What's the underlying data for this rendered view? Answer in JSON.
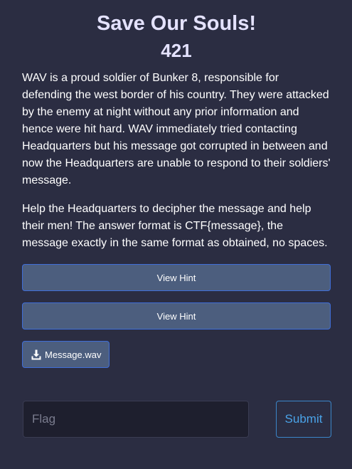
{
  "challenge": {
    "title": "Save Our Souls!",
    "points": "421",
    "description": [
      "WAV is a proud soldier of Bunker 8, responsible for defending the west border of his country. They were attacked by the enemy at night without any prior information and hence were hit hard. WAV immediately tried contacting Headquarters but his message got corrupted in between and now the Headquarters are unable to respond to their soldiers' message.",
      "Help the Headquarters to decipher the message and help their men! The answer format is CTF{message}, the message exactly in the same format as obtained, no spaces."
    ],
    "hints": [
      {
        "label": "View Hint"
      },
      {
        "label": "View Hint"
      }
    ],
    "file": {
      "label": "Message.wav",
      "icon": "download-icon"
    }
  },
  "flag_form": {
    "placeholder": "Flag",
    "value": "",
    "submit_label": "Submit"
  },
  "colors": {
    "background": "#2b2d42",
    "title": "#e4e2ff",
    "button_bg": "#4c5e7e",
    "button_border": "#3f6ed8",
    "submit_text": "#4aa3e8"
  }
}
